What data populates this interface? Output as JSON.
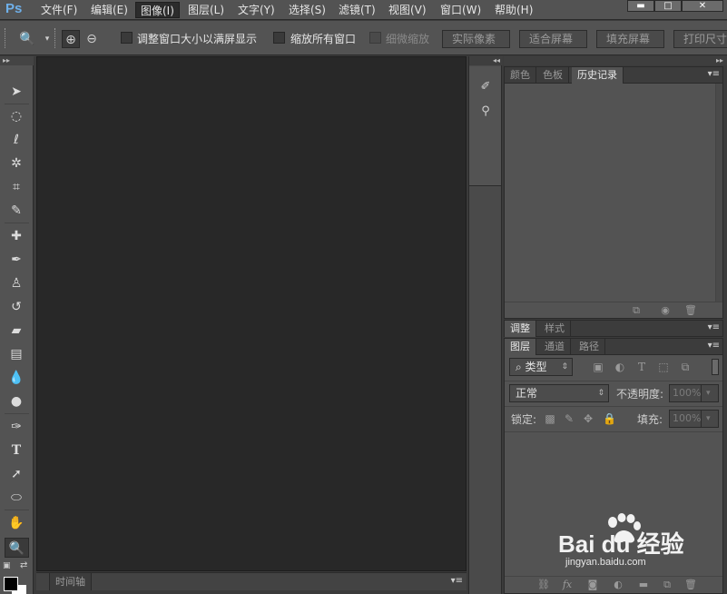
{
  "app": {
    "logo": "Ps"
  },
  "menubar": {
    "items": [
      "文件(F)",
      "编辑(E)",
      "图像(I)",
      "图层(L)",
      "文字(Y)",
      "选择(S)",
      "滤镜(T)",
      "视图(V)",
      "窗口(W)",
      "帮助(H)"
    ],
    "active_index": 2,
    "window_buttons": {
      "minimize": "▬",
      "maximize": "□",
      "close": "✕"
    }
  },
  "options": {
    "zoom_tool_icon": "🔍",
    "zoom_in_icon": "⊕",
    "zoom_out_icon": "⊖",
    "resize_windows_label": "调整窗口大小以满屏显示",
    "zoom_all_windows_label": "缩放所有窗口",
    "scrubby_zoom_label": "细微缩放",
    "buttons": [
      "实际像素",
      "适合屏幕",
      "填充屏幕",
      "打印尺寸"
    ]
  },
  "toolbar": {
    "collapse": "▸▸",
    "tools": [
      {
        "name": "move-tool",
        "glyph": "➤"
      },
      {
        "name": "marquee-tool",
        "glyph": "◌"
      },
      {
        "name": "lasso-tool",
        "glyph": "ℓ"
      },
      {
        "name": "magic-wand-tool",
        "glyph": "✲"
      },
      {
        "name": "crop-tool",
        "glyph": "⌗"
      },
      {
        "name": "eyedropper-tool",
        "glyph": "✎"
      },
      {
        "name": "healing-brush-tool",
        "glyph": "✚"
      },
      {
        "name": "brush-tool",
        "glyph": "✒"
      },
      {
        "name": "clone-stamp-tool",
        "glyph": "♙"
      },
      {
        "name": "history-brush-tool",
        "glyph": "↺"
      },
      {
        "name": "eraser-tool",
        "glyph": "▰"
      },
      {
        "name": "gradient-tool",
        "glyph": "▤"
      },
      {
        "name": "blur-tool",
        "glyph": "💧"
      },
      {
        "name": "dodge-tool",
        "glyph": "●"
      },
      {
        "name": "pen-tool",
        "glyph": "✑"
      },
      {
        "name": "type-tool",
        "glyph": "T"
      },
      {
        "name": "path-selection-tool",
        "glyph": "➚"
      },
      {
        "name": "ellipse-tool",
        "glyph": "⬭"
      },
      {
        "name": "hand-tool",
        "glyph": "✋"
      },
      {
        "name": "zoom-tool",
        "glyph": "🔍"
      }
    ],
    "selected_tool": "zoom-tool"
  },
  "timeline": {
    "tab": "时间轴",
    "menu": "▾≡"
  },
  "minidock": {
    "collapse": "◂◂",
    "icons": [
      "brushes-icon",
      "brush-presets-icon"
    ]
  },
  "panels": {
    "history_group": {
      "tabs": [
        "颜色",
        "色板",
        "历史记录"
      ],
      "active": 2,
      "menu": "▾≡"
    },
    "adjustments_group": {
      "tabs": [
        "调整",
        "样式"
      ],
      "active": 0,
      "menu": "▾≡"
    },
    "layers_group": {
      "tabs": [
        "图层",
        "通道",
        "路径"
      ],
      "active": 0,
      "menu": "▾≡",
      "filter_kind": "⌕ 类型",
      "blend_mode": "正常",
      "opacity_label": "不透明度:",
      "opacity_value": "100%",
      "lock_label": "锁定:",
      "fill_label": "填充:",
      "fill_value": "100%"
    },
    "right_collapse": "▸▸"
  },
  "watermark": {
    "logo": "Bai du 经验",
    "url": "jingyan.baidu.com"
  },
  "colors": {
    "accent_ps": "#6fb0ea",
    "panel_bg": "#535353",
    "canvas_bg": "#282828"
  }
}
